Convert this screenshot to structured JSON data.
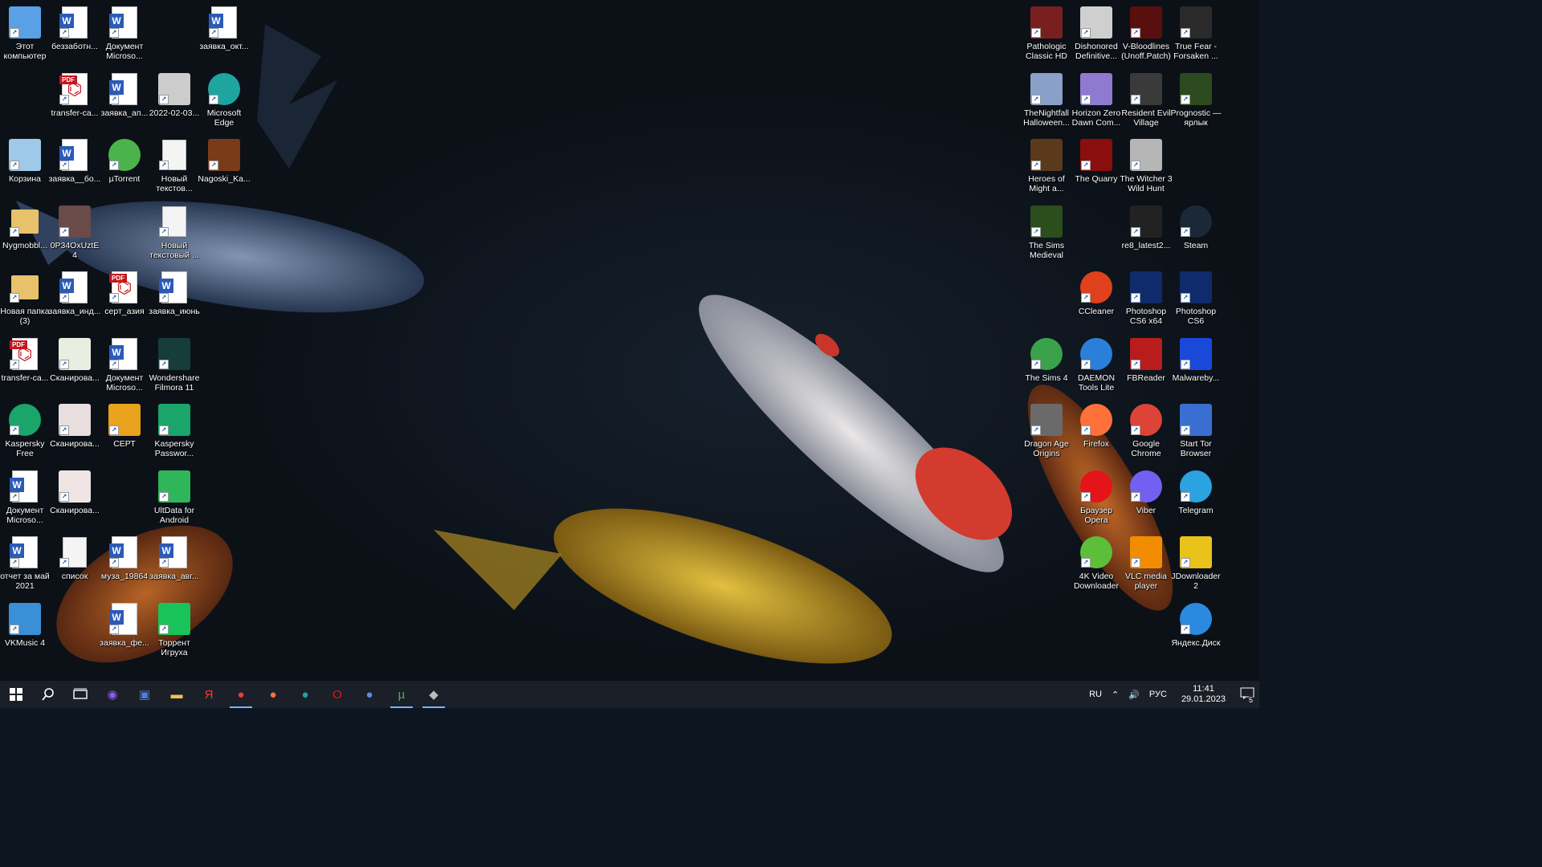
{
  "desktop": {
    "icons": [
      {
        "label": "Этот компьютер",
        "icon": "computer-icon",
        "col": 0,
        "row": 0,
        "color": "#5aa0e6"
      },
      {
        "label": "беззаботн...",
        "icon": "word-doc-icon",
        "col": 1,
        "row": 0,
        "color": "#2b5bb7"
      },
      {
        "label": "Документ Microso...",
        "icon": "word-doc-icon",
        "col": 2,
        "row": 0,
        "color": "#2b5bb7"
      },
      {
        "label": "заявка_окт...",
        "icon": "word-doc-icon",
        "col": 4,
        "row": 0,
        "color": "#2b5bb7"
      },
      {
        "label": "transfer-ca...",
        "icon": "pdf-icon",
        "col": 1,
        "row": 1,
        "color": "#c4171c"
      },
      {
        "label": "заявка_ап...",
        "icon": "word-doc-icon",
        "col": 2,
        "row": 1,
        "color": "#2b5bb7"
      },
      {
        "label": "2022-02-03...",
        "icon": "image-file-icon",
        "col": 3,
        "row": 1,
        "color": "#cccccc"
      },
      {
        "label": "Microsoft Edge",
        "icon": "edge-icon",
        "col": 4,
        "row": 1,
        "color": "#1fa5a0"
      },
      {
        "label": "Корзина",
        "icon": "recycle-bin-icon",
        "col": 0,
        "row": 2,
        "color": "#9ec9e8"
      },
      {
        "label": "заявка__бо...",
        "icon": "word-doc-icon",
        "col": 1,
        "row": 2,
        "color": "#2b5bb7"
      },
      {
        "label": "µTorrent",
        "icon": "utorrent-icon",
        "col": 2,
        "row": 2,
        "color": "#4bb34b"
      },
      {
        "label": "Новый текстов...",
        "icon": "text-file-icon",
        "col": 3,
        "row": 2,
        "color": "#eeeeee"
      },
      {
        "label": "Nagoski_Ka...",
        "icon": "fb2-book-icon",
        "col": 4,
        "row": 2,
        "color": "#7a3b1b"
      },
      {
        "label": "Nygmobbl...",
        "icon": "folder-user-icon",
        "col": 0,
        "row": 3,
        "color": "#e8c26a"
      },
      {
        "label": "0P34OxUztE4",
        "icon": "image-file-icon",
        "col": 1,
        "row": 3,
        "color": "#6b4a4a"
      },
      {
        "label": "Новый текстовый ...",
        "icon": "text-file-icon",
        "col": 3,
        "row": 3,
        "color": "#eeeeee"
      },
      {
        "label": "Новая папка (3)",
        "icon": "folder-icon",
        "col": 0,
        "row": 4,
        "color": "#e8c26a"
      },
      {
        "label": "заявка_инд...",
        "icon": "word-doc-icon",
        "col": 1,
        "row": 4,
        "color": "#2b5bb7"
      },
      {
        "label": "серт_азия",
        "icon": "pdf-icon",
        "col": 2,
        "row": 4,
        "color": "#c4171c"
      },
      {
        "label": "заявка_июнь",
        "icon": "word-doc-icon",
        "col": 3,
        "row": 4,
        "color": "#2b5bb7"
      },
      {
        "label": "transfer-ca...",
        "icon": "pdf-icon",
        "col": 0,
        "row": 5,
        "color": "#c4171c"
      },
      {
        "label": "Сканирова...",
        "icon": "scan-image-icon",
        "col": 1,
        "row": 5,
        "color": "#e8efe0"
      },
      {
        "label": "Документ Microso...",
        "icon": "word-doc-icon",
        "col": 2,
        "row": 5,
        "color": "#2b5bb7"
      },
      {
        "label": "Wondershare Filmora 11",
        "icon": "filmora-icon",
        "col": 3,
        "row": 5,
        "color": "#173d3b"
      },
      {
        "label": "Kaspersky Free",
        "icon": "kaspersky-icon",
        "col": 0,
        "row": 6,
        "color": "#1aa56a"
      },
      {
        "label": "Сканирова...",
        "icon": "scan-image-icon",
        "col": 1,
        "row": 6,
        "color": "#e8dede"
      },
      {
        "label": "СЕРТ",
        "icon": "psd-file-icon",
        "col": 2,
        "row": 6,
        "color": "#e8a21c"
      },
      {
        "label": "Kaspersky Passwor...",
        "icon": "kaspersky-password-icon",
        "col": 3,
        "row": 6,
        "color": "#1aa56a"
      },
      {
        "label": "Документ Microso...",
        "icon": "word-doc-icon",
        "col": 0,
        "row": 7,
        "color": "#2b5bb7"
      },
      {
        "label": "Сканирова...",
        "icon": "scan-image-icon",
        "col": 1,
        "row": 7,
        "color": "#efe4e4"
      },
      {
        "label": "UltData for Android",
        "icon": "ultdata-icon",
        "col": 3,
        "row": 7,
        "color": "#2fb55a"
      },
      {
        "label": "отчет за май 2021",
        "icon": "word-doc-icon",
        "col": 0,
        "row": 8,
        "color": "#2b5bb7"
      },
      {
        "label": "список",
        "icon": "text-file-icon",
        "col": 1,
        "row": 8,
        "color": "#eeeeee"
      },
      {
        "label": "муза_19864",
        "icon": "word-doc-icon",
        "col": 2,
        "row": 8,
        "color": "#2b5bb7"
      },
      {
        "label": "заявка_авг...",
        "icon": "word-doc-icon",
        "col": 3,
        "row": 8,
        "color": "#2b5bb7"
      },
      {
        "label": "VKMusic 4",
        "icon": "vkmusic-icon",
        "col": 0,
        "row": 9,
        "color": "#3a8fd6"
      },
      {
        "label": "заявка_фе...",
        "icon": "word-doc-icon",
        "col": 2,
        "row": 9,
        "color": "#2b5bb7"
      },
      {
        "label": "Торрент Игруха",
        "icon": "torrent-igruha-icon",
        "col": 3,
        "row": 9,
        "color": "#18c35a"
      },
      {
        "label": "Pathologic Classic HD",
        "icon": "pathologic-icon",
        "col": 21,
        "row": 0,
        "color": "#7a1f1f"
      },
      {
        "label": "Dishonored Definitive...",
        "icon": "dishonored-icon",
        "col": 22,
        "row": 0,
        "color": "#cfcfcf"
      },
      {
        "label": "V-Bloodlines (Unoff.Patch)",
        "icon": "vampire-icon",
        "col": 23,
        "row": 0,
        "color": "#5a0f0f"
      },
      {
        "label": "True Fear - Forsaken ...",
        "icon": "true-fear-icon",
        "col": 24,
        "row": 0,
        "color": "#2a2a2a"
      },
      {
        "label": "TheNightfall Halloween...",
        "icon": "nightfall-icon",
        "col": 21,
        "row": 1,
        "color": "#8aa0c8"
      },
      {
        "label": "Horizon Zero Dawn Com...",
        "icon": "horizon-icon",
        "col": 22,
        "row": 1,
        "color": "#8e7bd1"
      },
      {
        "label": "Resident Evil Village",
        "icon": "resident-evil-icon",
        "col": 23,
        "row": 1,
        "color": "#3a3a3a"
      },
      {
        "label": "Prognostic — ярлык",
        "icon": "prognostic-icon",
        "col": 24,
        "row": 1,
        "color": "#2d4a1e"
      },
      {
        "label": "Heroes of Might a...",
        "icon": "heroes-icon",
        "col": 21,
        "row": 2,
        "color": "#5a3a1a"
      },
      {
        "label": "The Quarry",
        "icon": "the-quarry-icon",
        "col": 22,
        "row": 2,
        "color": "#8a0e0e"
      },
      {
        "label": "The Witcher 3 Wild Hunt",
        "icon": "witcher-icon",
        "col": 23,
        "row": 2,
        "color": "#b6b6b6"
      },
      {
        "label": "The Sims Medieval",
        "icon": "sims-medieval-icon",
        "col": 21,
        "row": 3,
        "color": "#2c4d1c"
      },
      {
        "label": "re8_latest2...",
        "icon": "image-file-icon",
        "col": 23,
        "row": 3,
        "color": "#222222"
      },
      {
        "label": "Steam",
        "icon": "steam-icon",
        "col": 24,
        "row": 3,
        "color": "#1b2838"
      },
      {
        "label": "CCleaner",
        "icon": "ccleaner-icon",
        "col": 22,
        "row": 4,
        "color": "#e0401c"
      },
      {
        "label": "Photoshop CS6 x64",
        "icon": "photoshop-icon",
        "col": 23,
        "row": 4,
        "color": "#0f2b6b"
      },
      {
        "label": "Photoshop CS6",
        "icon": "photoshop-icon",
        "col": 24,
        "row": 4,
        "color": "#0f2b6b"
      },
      {
        "label": "The Sims 4",
        "icon": "sims4-icon",
        "col": 21,
        "row": 5,
        "color": "#3aa24b"
      },
      {
        "label": "DAEMON Tools Lite",
        "icon": "daemon-tools-icon",
        "col": 22,
        "row": 5,
        "color": "#2a7fd8"
      },
      {
        "label": "FBReader",
        "icon": "fbreader-icon",
        "col": 23,
        "row": 5,
        "color": "#b81c1c"
      },
      {
        "label": "Malwareby...",
        "icon": "malwarebytes-icon",
        "col": 24,
        "row": 5,
        "color": "#1a48d8"
      },
      {
        "label": "Dragon Age Origins",
        "icon": "dragon-age-icon",
        "col": 21,
        "row": 6,
        "color": "#6a6a6a"
      },
      {
        "label": "Firefox",
        "icon": "firefox-icon",
        "col": 22,
        "row": 6,
        "color": "#ff7139"
      },
      {
        "label": "Google Chrome",
        "icon": "chrome-icon",
        "col": 23,
        "row": 6,
        "color": "#db4437"
      },
      {
        "label": "Start Tor Browser",
        "icon": "tor-browser-icon",
        "col": 24,
        "row": 6,
        "color": "#3a6fd1"
      },
      {
        "label": "Браузер Opera",
        "icon": "opera-icon",
        "col": 22,
        "row": 7,
        "color": "#e4141a"
      },
      {
        "label": "Viber",
        "icon": "viber-icon",
        "col": 23,
        "row": 7,
        "color": "#7360f2"
      },
      {
        "label": "Telegram",
        "icon": "telegram-icon",
        "col": 24,
        "row": 7,
        "color": "#2aa3e0"
      },
      {
        "label": "4K Video Downloader",
        "icon": "4k-downloader-icon",
        "col": 22,
        "row": 8,
        "color": "#5bbf3a"
      },
      {
        "label": "VLC media player",
        "icon": "vlc-icon",
        "col": 23,
        "row": 8,
        "color": "#f28c00"
      },
      {
        "label": "JDownloader 2",
        "icon": "jdownloader-icon",
        "col": 24,
        "row": 8,
        "color": "#e9c21a"
      },
      {
        "label": "Яндекс.Диск",
        "icon": "yandex-disk-icon",
        "col": 24,
        "row": 9,
        "color": "#2a8ae0"
      }
    ]
  },
  "taskbar": {
    "start_icon": "windows-logo-icon",
    "search_icon": "search-icon",
    "taskview_icon": "task-view-icon",
    "pinned": [
      {
        "name": "cortana-icon",
        "glyph": "◉",
        "color": "#8b5cf6",
        "active": false
      },
      {
        "name": "save-disk-icon",
        "glyph": "▣",
        "color": "#4f7fd8",
        "active": false
      },
      {
        "name": "file-explorer-icon",
        "glyph": "▬",
        "color": "#f2c14e",
        "active": false
      },
      {
        "name": "yandex-browser-icon",
        "glyph": "Я",
        "color": "#ff3333",
        "active": false
      },
      {
        "name": "chrome-icon",
        "glyph": "●",
        "color": "#db4437",
        "active": true
      },
      {
        "name": "firefox-icon",
        "glyph": "●",
        "color": "#ff7139",
        "active": false
      },
      {
        "name": "edge-icon",
        "glyph": "●",
        "color": "#1fa5a0",
        "active": false
      },
      {
        "name": "opera-icon",
        "glyph": "O",
        "color": "#e4141a",
        "active": false
      },
      {
        "name": "chromium-icon",
        "glyph": "●",
        "color": "#5a8de8",
        "active": false
      },
      {
        "name": "utorrent-icon",
        "glyph": "µ",
        "color": "#4bb34b",
        "active": true
      },
      {
        "name": "dishonored-icon",
        "glyph": "◆",
        "color": "#bbbbbb",
        "active": true
      }
    ],
    "tray": {
      "language": "RU",
      "input": "РУС",
      "time": "11:41",
      "date": "29.01.2023",
      "notifications": "5"
    }
  }
}
